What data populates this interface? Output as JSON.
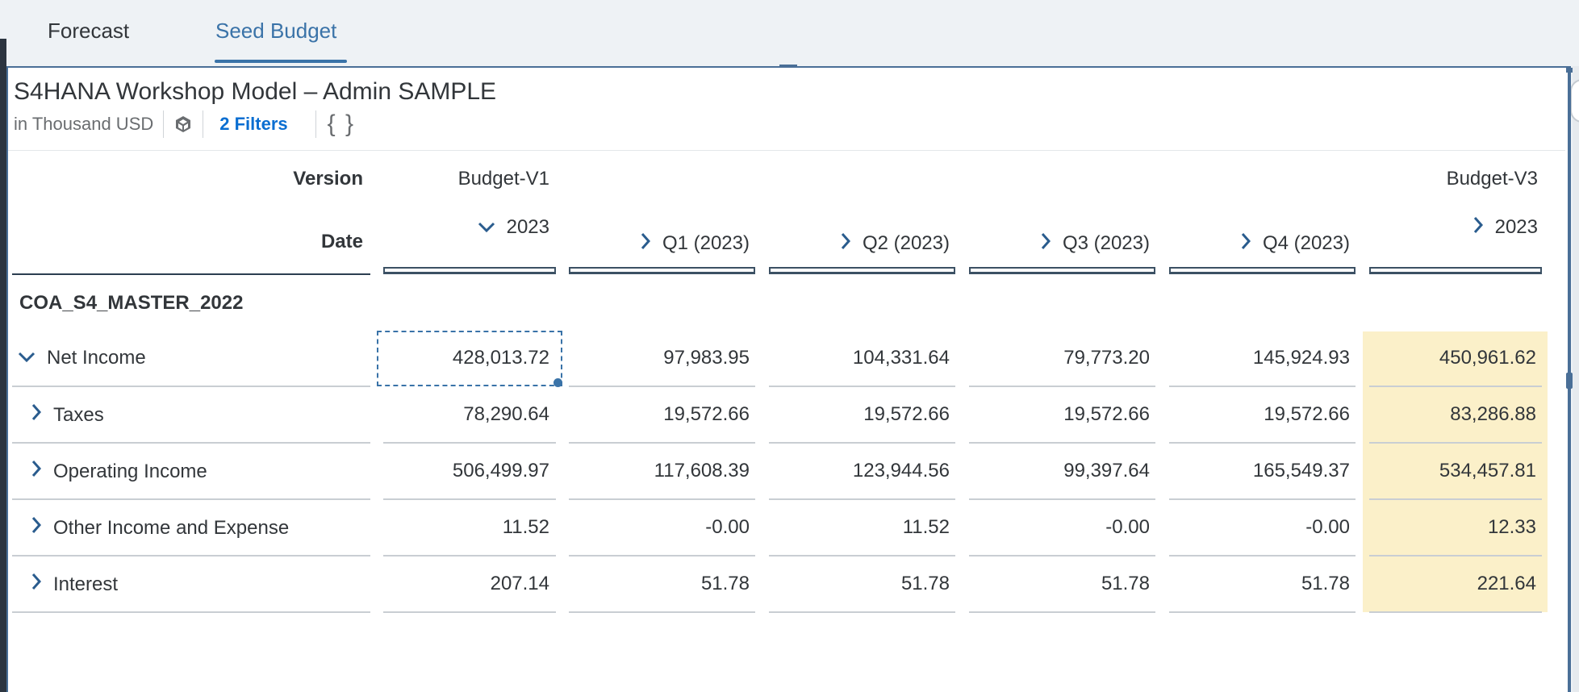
{
  "tabs": [
    {
      "label": "Forecast",
      "active": false
    },
    {
      "label": "Seed Budget",
      "active": true
    }
  ],
  "widget": {
    "title": "S4HANA Workshop Model – Admin SAMPLE",
    "units": "in Thousand USD",
    "filters_label": "2 Filters",
    "braces": "{ }",
    "icons": {
      "model": "cube-icon"
    }
  },
  "table": {
    "version_label": "Version",
    "date_label": "Date",
    "section_label": "COA_S4_MASTER_2022",
    "versions": [
      "Budget-V1",
      "Budget-V3"
    ],
    "columns": [
      {
        "label": "2023",
        "expanded": true
      },
      {
        "label": "Q1 (2023)",
        "expanded": false
      },
      {
        "label": "Q2 (2023)",
        "expanded": false
      },
      {
        "label": "Q3 (2023)",
        "expanded": false
      },
      {
        "label": "Q4 (2023)",
        "expanded": false
      },
      {
        "label": "2023",
        "expanded": false
      }
    ],
    "rows": [
      {
        "label": "Net Income",
        "expanded": true,
        "values": [
          "428,013.72",
          "97,983.95",
          "104,331.64",
          "79,773.20",
          "145,924.93",
          "450,961.62"
        ]
      },
      {
        "label": "Taxes",
        "expanded": false,
        "values": [
          "78,290.64",
          "19,572.66",
          "19,572.66",
          "19,572.66",
          "19,572.66",
          "83,286.88"
        ]
      },
      {
        "label": "Operating Income",
        "expanded": false,
        "values": [
          "506,499.97",
          "117,608.39",
          "123,944.56",
          "99,397.64",
          "165,549.37",
          "534,457.81"
        ]
      },
      {
        "label": "Other Income and Expense",
        "expanded": false,
        "values": [
          "11.52",
          "-0.00",
          "11.52",
          "-0.00",
          "-0.00",
          "12.33"
        ]
      },
      {
        "label": "Interest",
        "expanded": false,
        "values": [
          "207.14",
          "51.78",
          "51.78",
          "51.78",
          "51.78",
          "221.64"
        ]
      }
    ]
  },
  "colors": {
    "accent": "#3a73a8",
    "highlight": "#fbf0c9",
    "link": "#0a6ed1"
  }
}
